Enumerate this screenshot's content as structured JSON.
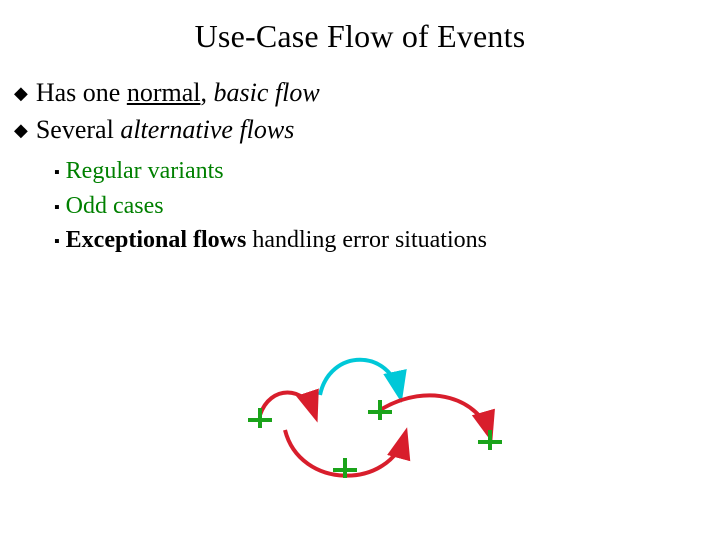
{
  "title": "Use-Case Flow of Events",
  "bullets": {
    "b1a_pre": "Has one ",
    "b1a_under": "normal",
    "b1a_mid": ", ",
    "b1a_italic": "basic flow",
    "b1b_pre": "Several ",
    "b1b_italic": "alternative flows"
  },
  "sub": {
    "s1": "Regular variants",
    "s2": "Odd cases",
    "s3_bold": "Exceptional flows",
    "s3_rest": " handling error situations"
  },
  "glyphs": {
    "diamond": "◆",
    "square": "▪"
  },
  "diagram": {
    "description": "Flow diagram with cyan arc and red/green branching arrows",
    "colors": {
      "cyan": "#00c8d8",
      "red": "#d81e2c",
      "green": "#1aa31a"
    }
  }
}
